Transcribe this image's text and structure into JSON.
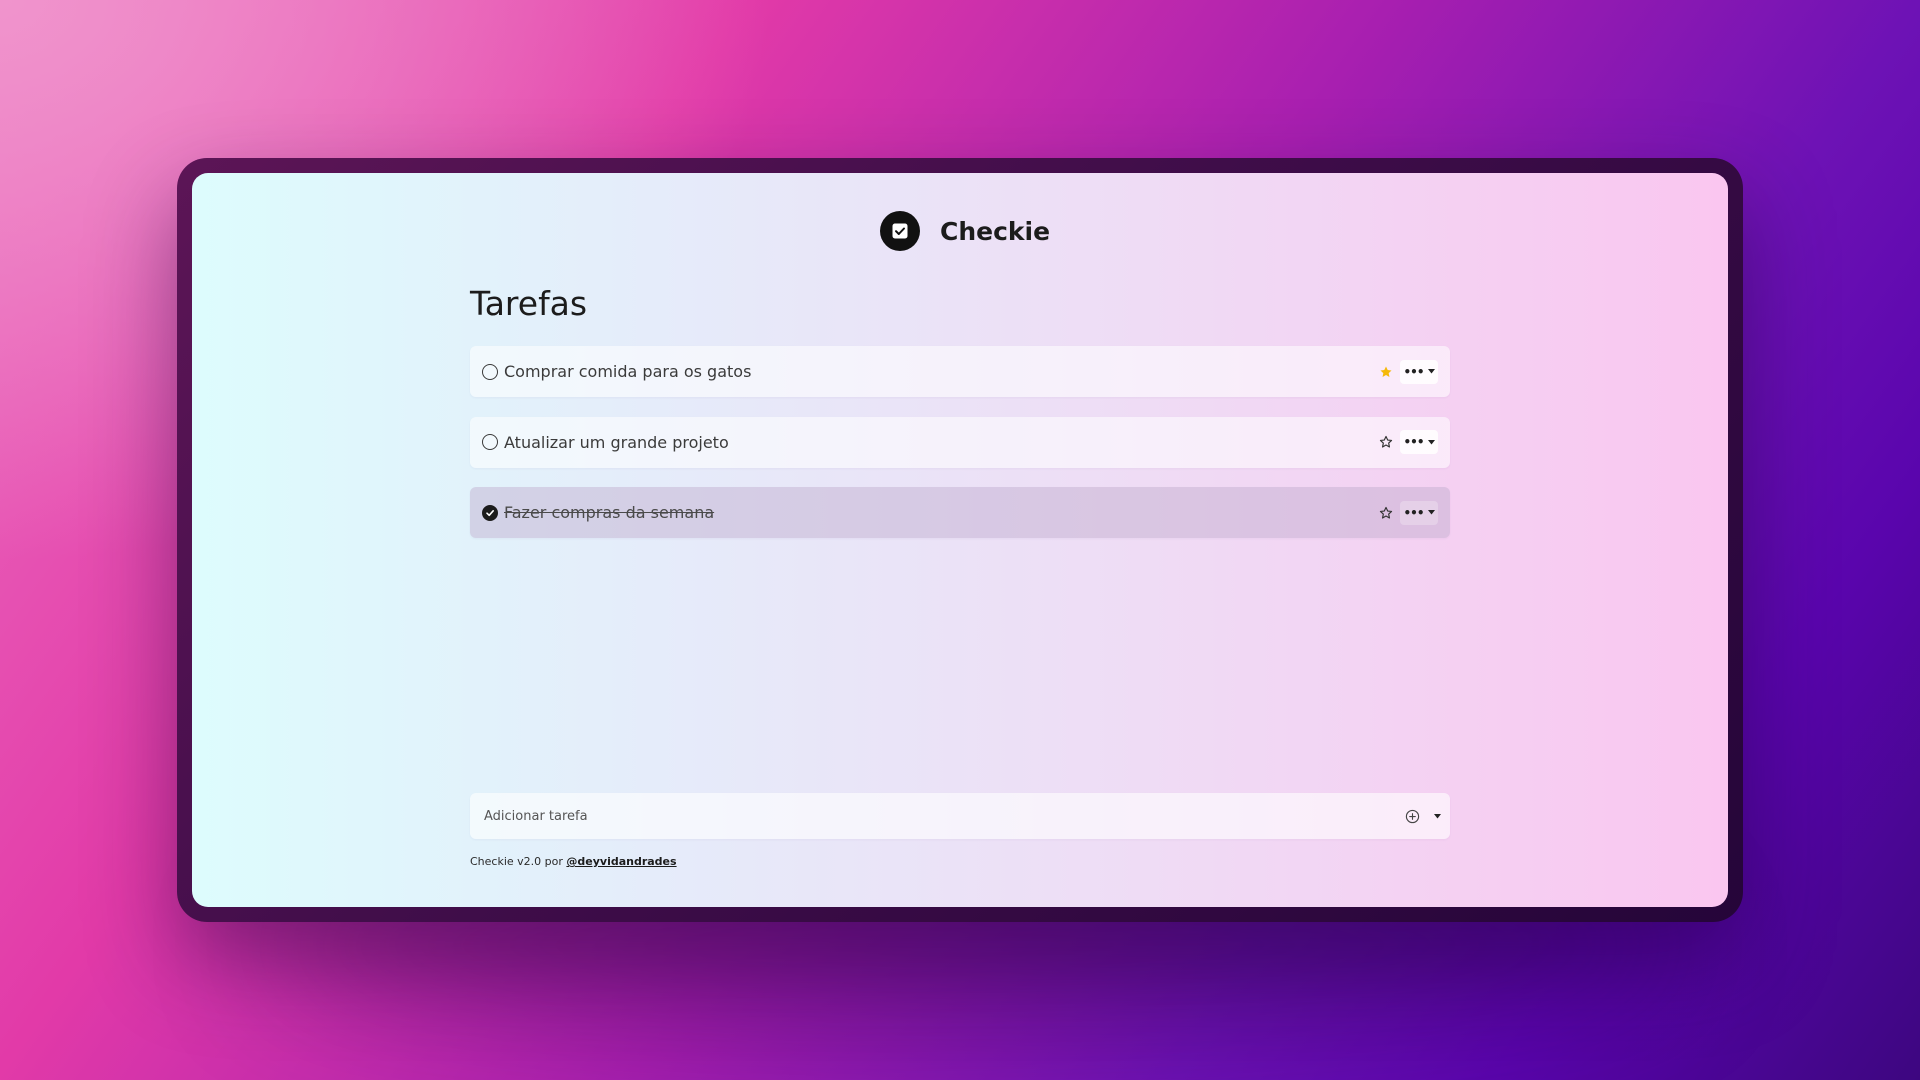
{
  "app": {
    "name": "Checkie"
  },
  "page": {
    "title": "Tarefas"
  },
  "tasks": [
    {
      "label": "Comprar comida para os gatos",
      "completed": false,
      "starred": true,
      "star_icon": "star-filled-icon",
      "menu_icon": "more-dots-icon"
    },
    {
      "label": "Atualizar um grande projeto",
      "completed": false,
      "starred": false,
      "star_icon": "star-outline-icon",
      "menu_icon": "more-dots-icon"
    },
    {
      "label": "Fazer compras da semana",
      "completed": true,
      "starred": false,
      "star_icon": "star-outline-icon",
      "menu_icon": "more-dots-icon"
    }
  ],
  "add_task": {
    "placeholder": "Adicionar tarefa",
    "add_icon": "plus-circle-icon",
    "caret_icon": "caret-down-icon"
  },
  "footer": {
    "text": "Checkie v2.0 por ",
    "author_link": "@deyvidandrades"
  },
  "colors": {
    "star_active": "#f5b90a",
    "logo_background": "#111111",
    "completed_row": "#c9b6d3"
  }
}
